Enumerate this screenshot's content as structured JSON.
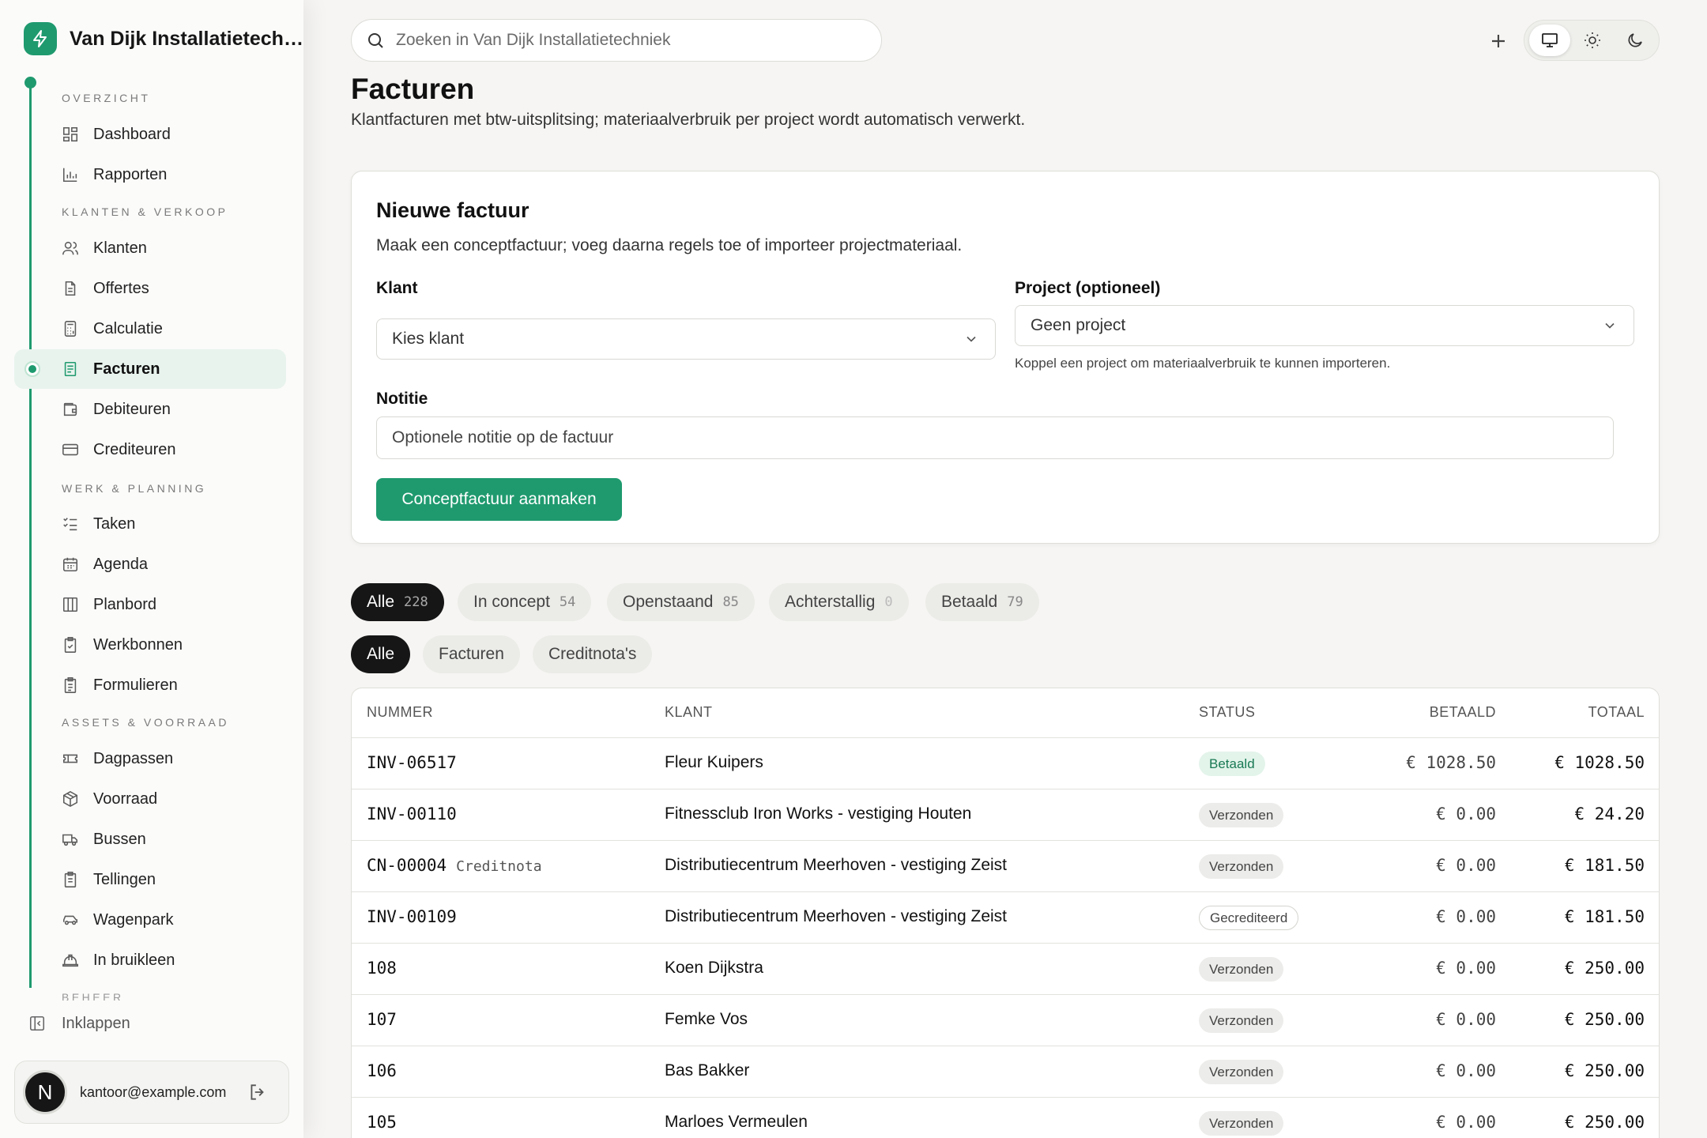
{
  "brand": {
    "name": "Van Dijk Installatietechniek"
  },
  "nav": {
    "sections": {
      "overzicht": "OVERZICHT",
      "klanten": "KLANTEN & VERKOOP",
      "werk": "WERK & PLANNING",
      "assets": "ASSETS & VOORRAAD",
      "beheer": "BEHEER"
    },
    "items": {
      "dashboard": "Dashboard",
      "rapporten": "Rapporten",
      "klanten": "Klanten",
      "offertes": "Offertes",
      "calculatie": "Calculatie",
      "facturen": "Facturen",
      "debiteuren": "Debiteuren",
      "crediteuren": "Crediteuren",
      "taken": "Taken",
      "agenda": "Agenda",
      "planbord": "Planbord",
      "werkbonnen": "Werkbonnen",
      "formulieren": "Formulieren",
      "dagpassen": "Dagpassen",
      "voorraad": "Voorraad",
      "bussen": "Bussen",
      "tellingen": "Tellingen",
      "wagenpark": "Wagenpark",
      "inbruikleen": "In bruikleen"
    },
    "collapse": "Inklappen"
  },
  "user": {
    "initial": "N",
    "email": "kantoor@example.com"
  },
  "search": {
    "placeholder": "Zoeken in Van Dijk Installatietechniek"
  },
  "page": {
    "title": "Facturen",
    "subtitle": "Klantfacturen met btw-uitsplitsing; materiaalverbruik per project wordt automatisch verwerkt."
  },
  "form": {
    "title": "Nieuwe factuur",
    "description": "Maak een conceptfactuur; voeg daarna regels toe of importeer projectmateriaal.",
    "klant_label": "Klant",
    "klant_value": "Kies klant",
    "project_label": "Project (optioneel)",
    "project_value": "Geen project",
    "project_hint": "Koppel een project om materiaalverbruik te kunnen importeren.",
    "note_label": "Notitie",
    "note_placeholder": "Optionele notitie op de factuur",
    "submit_label": "Conceptfactuur aanmaken"
  },
  "status_filters": [
    {
      "label": "Alle",
      "count": "228"
    },
    {
      "label": "In concept",
      "count": "54"
    },
    {
      "label": "Openstaand",
      "count": "85"
    },
    {
      "label": "Achterstallig",
      "count": "0"
    },
    {
      "label": "Betaald",
      "count": "79"
    }
  ],
  "type_filters": [
    "Alle",
    "Facturen",
    "Creditnota's"
  ],
  "table": {
    "headers": {
      "nummer": "NUMMER",
      "klant": "KLANT",
      "status": "STATUS",
      "betaald": "BETAALD",
      "totaal": "TOTAAL"
    },
    "rows": [
      {
        "nummer": "INV-06517",
        "tag": "",
        "klant": "Fleur Kuipers",
        "status": "Betaald",
        "betaald": "€ 1028.50",
        "totaal": "€ 1028.50"
      },
      {
        "nummer": "INV-00110",
        "tag": "",
        "klant": "Fitnessclub Iron Works - vestiging Houten",
        "status": "Verzonden",
        "betaald": "€ 0.00",
        "totaal": "€ 24.20"
      },
      {
        "nummer": "CN-00004",
        "tag": "Creditnota",
        "klant": "Distributiecentrum Meerhoven - vestiging Zeist",
        "status": "Verzonden",
        "betaald": "€ 0.00",
        "totaal": "€ 181.50"
      },
      {
        "nummer": "INV-00109",
        "tag": "",
        "klant": "Distributiecentrum Meerhoven - vestiging Zeist",
        "status": "Gecrediteerd",
        "betaald": "€ 0.00",
        "totaal": "€ 181.50"
      },
      {
        "nummer": "108",
        "tag": "",
        "klant": "Koen Dijkstra",
        "status": "Verzonden",
        "betaald": "€ 0.00",
        "totaal": "€ 250.00"
      },
      {
        "nummer": "107",
        "tag": "",
        "klant": "Femke Vos",
        "status": "Verzonden",
        "betaald": "€ 0.00",
        "totaal": "€ 250.00"
      },
      {
        "nummer": "106",
        "tag": "",
        "klant": "Bas Bakker",
        "status": "Verzonden",
        "betaald": "€ 0.00",
        "totaal": "€ 250.00"
      },
      {
        "nummer": "105",
        "tag": "",
        "klant": "Marloes Vermeulen",
        "status": "Verzonden",
        "betaald": "€ 0.00",
        "totaal": "€ 250.00"
      }
    ]
  },
  "colors": {
    "accent": "#1f9a6f",
    "dark": "#161616"
  }
}
